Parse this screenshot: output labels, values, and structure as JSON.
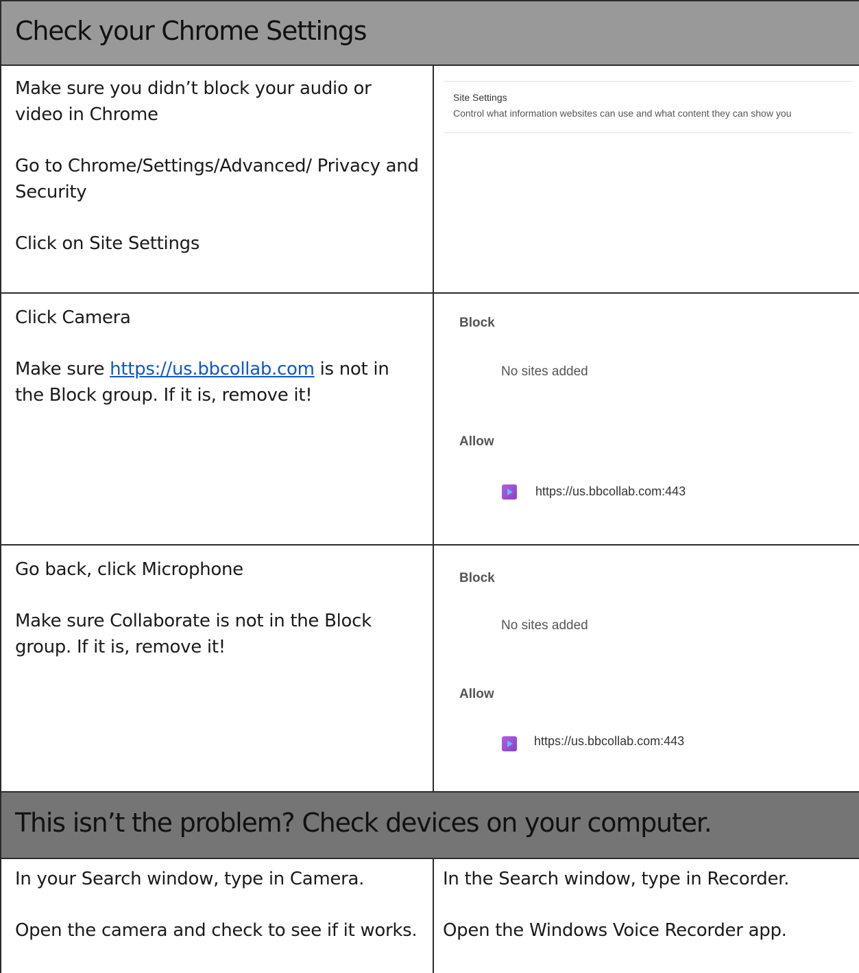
{
  "header1": "Check your Chrome Settings",
  "row1": {
    "p1": "Make sure you didn’t block your audio or video in Chrome",
    "p2": "Go to Chrome/Settings/Advanced/ Privacy and Security",
    "p3": "Click on Site Settings",
    "screenshot": {
      "title": "Site Settings",
      "desc": "Control what information websites can use and what content they can show you"
    }
  },
  "row2": {
    "p1": "Click Camera",
    "p2_before": "Make sure ",
    "p2_link": "https://us.bbcollab.com",
    "p2_after": " is not in the Block group.  If it is, remove it!",
    "block_label": "Block",
    "no_sites": "No sites added",
    "allow_label": "Allow",
    "site": "https://us.bbcollab.com:443"
  },
  "row3": {
    "p1": "Go back, click Microphone",
    "p2": "Make sure Collaborate is not in the Block group.  If it is, remove it!",
    "block_label": "Block",
    "no_sites": "No sites added",
    "allow_label": "Allow",
    "site": "https://us.bbcollab.com:443"
  },
  "header2": "This isn’t the problem?  Check devices on your computer.",
  "row4": {
    "left_p1": "In your Search window, type in Camera.",
    "left_p2": "Open the camera and check to see if it works.",
    "right_p1": "In the Search window, type in Recorder.",
    "right_p2": "Open the Windows Voice Recorder app."
  },
  "colors": {
    "header1_bg": "#999999",
    "header2_bg": "#757575",
    "link": "#1155cc",
    "favicon": "#a84fd8"
  }
}
